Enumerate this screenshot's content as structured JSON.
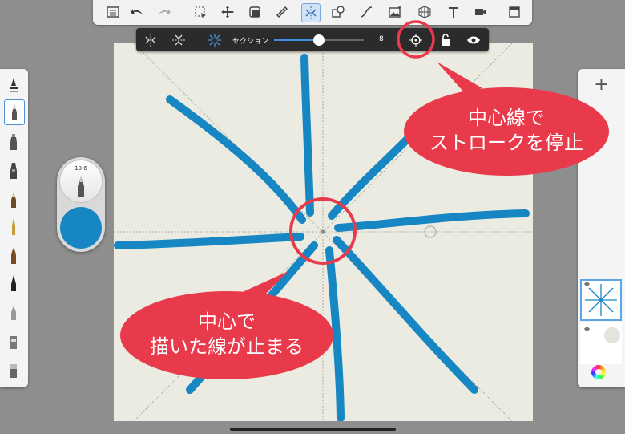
{
  "top_toolbar": {
    "tools": [
      {
        "name": "list-icon"
      },
      {
        "name": "undo-icon"
      },
      {
        "name": "redo-icon"
      },
      {
        "name": "select-icon"
      },
      {
        "name": "transform-icon"
      },
      {
        "name": "guides-icon"
      },
      {
        "name": "ruler-icon"
      },
      {
        "name": "symmetry-icon",
        "active": true
      },
      {
        "name": "shapes-icon"
      },
      {
        "name": "curve-icon"
      },
      {
        "name": "image-icon"
      },
      {
        "name": "perspective-icon"
      },
      {
        "name": "text-icon",
        "glyph": "T"
      },
      {
        "name": "video-icon"
      },
      {
        "name": "fullscreen-icon"
      }
    ]
  },
  "symmetry_bar": {
    "section_label": "セクション",
    "section_value": "8",
    "slider_fraction": 0.5
  },
  "brush_puck": {
    "size_value": "19.6",
    "color": "#1687c2"
  },
  "layers_panel": {
    "add_label": "+"
  },
  "callouts": {
    "top_line1": "中心線で",
    "top_line2": "ストロークを停止",
    "bottom_line1": "中心で",
    "bottom_line2": "描いた線が止まる"
  },
  "colors": {
    "stroke": "#1687c2",
    "callout": "#e83a4b",
    "canvas": "#ebebe2",
    "accent": "#3f8fde"
  }
}
